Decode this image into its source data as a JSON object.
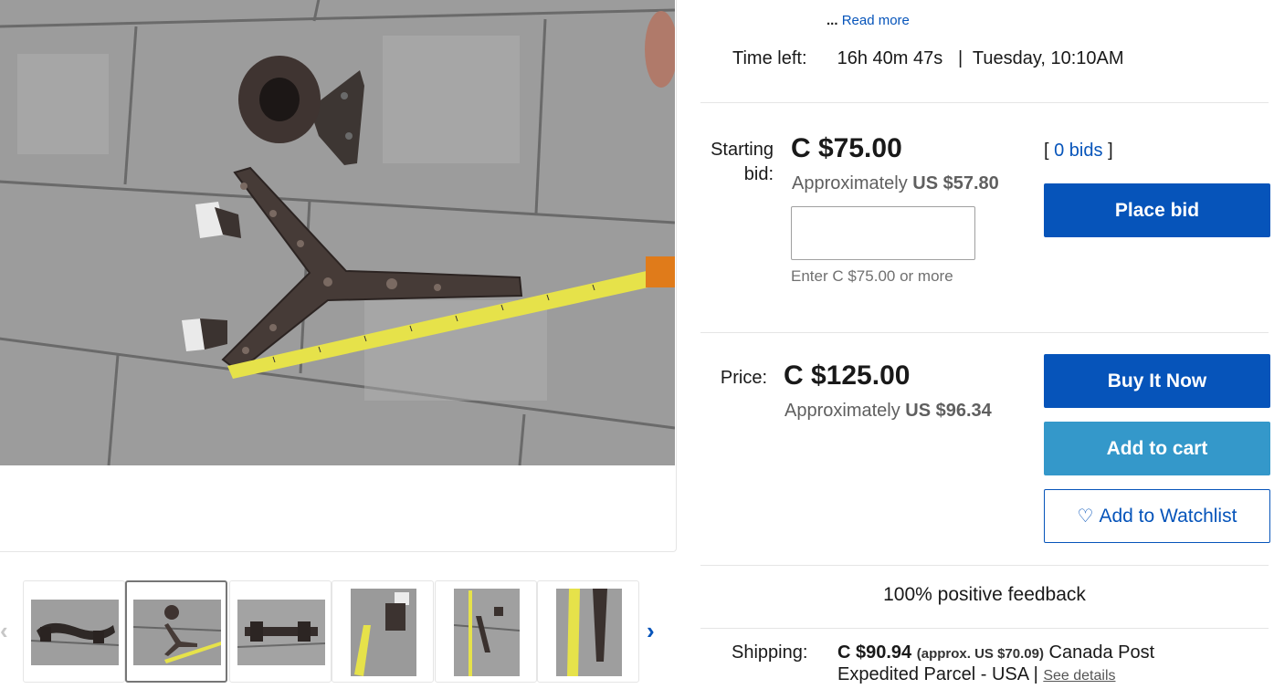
{
  "listing": {
    "read_more_prefix": "...",
    "read_more": "Read more",
    "time_left_label": "Time left:",
    "time_left_value": "16h 40m 47s",
    "time_sep": "|",
    "end_time": "Tuesday, 10:10AM"
  },
  "auction": {
    "label_line1": "Starting",
    "label_line2": "bid:",
    "price": "C $75.00",
    "approx_prefix": "Approximately",
    "approx_value": "US $57.80",
    "bids_open": "[",
    "bids_link": "0 bids",
    "bids_close": "]",
    "place_bid": "Place bid",
    "input_value": "",
    "hint": "Enter C $75.00 or more"
  },
  "buy_now": {
    "label": "Price:",
    "price": "C $125.00",
    "approx_prefix": "Approximately",
    "approx_value": "US $96.34",
    "buy_it_now": "Buy It Now",
    "add_to_cart": "Add to cart",
    "watch_icon": "heart-icon",
    "add_to_watchlist": "Add to Watchlist"
  },
  "seller": {
    "feedback": "100% positive feedback"
  },
  "shipping": {
    "label": "Shipping:",
    "cost": "C $90.94",
    "approx": "(approx. US $70.09)",
    "carrier_part1": "Canada Post",
    "carrier_part2": "Expedited Parcel - USA",
    "sep": "|",
    "see_details": "See details"
  },
  "gallery": {
    "prev_icon": "chevron-left-icon",
    "next_icon": "chevron-right-icon",
    "thumbnail_count": 6,
    "selected_index": 2
  },
  "colors": {
    "primary_blue": "#0654ba",
    "secondary_blue": "#3498ca",
    "text": "#191919",
    "muted": "#5f5f5f",
    "divider": "#e5e5e5"
  }
}
